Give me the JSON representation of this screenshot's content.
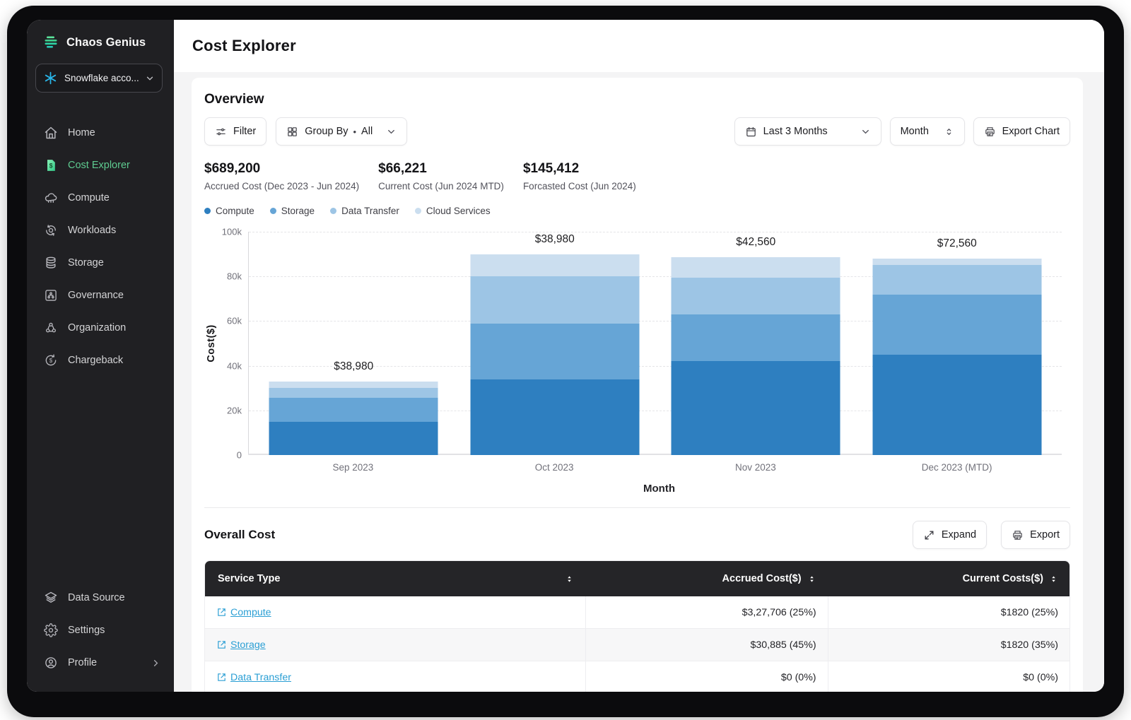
{
  "sidebar": {
    "brand": "Chaos Genius",
    "account_label": "Snowflake acco...",
    "nav": [
      {
        "label": "Home"
      },
      {
        "label": "Cost Explorer"
      },
      {
        "label": "Compute"
      },
      {
        "label": "Workloads"
      },
      {
        "label": "Storage"
      },
      {
        "label": "Governance"
      },
      {
        "label": "Organization"
      },
      {
        "label": "Chargeback"
      }
    ],
    "bottom_nav": [
      {
        "label": "Data Source"
      },
      {
        "label": "Settings"
      },
      {
        "label": "Profile"
      }
    ]
  },
  "header": {
    "title": "Cost Explorer"
  },
  "overview": {
    "title": "Overview",
    "filter_label": "Filter",
    "group_by_label": "Group By",
    "group_by_separator": "•",
    "group_by_value": "All",
    "date_range_value": "Last 3 Months",
    "granularity_value": "Month",
    "export_chart_label": "Export Chart",
    "stats": [
      {
        "value": "$689,200",
        "label": "Accrued Cost (Dec 2023 - Jun 2024)"
      },
      {
        "value": "$66,221",
        "label": "Current Cost (Jun 2024 MTD)"
      },
      {
        "value": "$145,412",
        "label": "Forcasted Cost (Jun 2024)"
      }
    ]
  },
  "chart_data": {
    "type": "bar",
    "stacked": true,
    "xlabel": "Month",
    "ylabel": "Cost($)",
    "ylim": [
      0,
      100000
    ],
    "yticks": [
      "100k",
      "80k",
      "60k",
      "40k",
      "20k",
      "0"
    ],
    "grid": "dashed-horizontal",
    "legend_position": "top-left",
    "categories": [
      "Sep 2023",
      "Oct 2023",
      "Nov 2023",
      "Dec 2023 (MTD)"
    ],
    "bar_total_labels": [
      "$38,980",
      "$38,980",
      "$42,560",
      "$72,560"
    ],
    "series": [
      {
        "name": "Compute",
        "color": "#2e7fc0",
        "values": [
          15000,
          34000,
          42000,
          45000
        ]
      },
      {
        "name": "Storage",
        "color": "#66a5d6",
        "values": [
          10500,
          25000,
          21000,
          27000
        ]
      },
      {
        "name": "Data Transfer",
        "color": "#9dc5e5",
        "values": [
          4500,
          21000,
          16500,
          13000
        ]
      },
      {
        "name": "Cloud Services",
        "color": "#cbdeef",
        "values": [
          3000,
          10000,
          9000,
          3000
        ]
      }
    ]
  },
  "overall_cost": {
    "title": "Overall Cost",
    "expand_label": "Expand",
    "export_label": "Export",
    "columns": [
      "Service Type",
      "Accrued Cost($)",
      "Current Costs($)"
    ],
    "rows": [
      {
        "service": "Compute",
        "accrued": "$3,27,706 (25%)",
        "current": "$1820 (25%)"
      },
      {
        "service": "Storage",
        "accrued": "$30,885 (45%)",
        "current": "$1820 (35%)"
      },
      {
        "service": "Data Transfer",
        "accrued": "$0 (0%)",
        "current": "$0 (0%)"
      }
    ]
  }
}
